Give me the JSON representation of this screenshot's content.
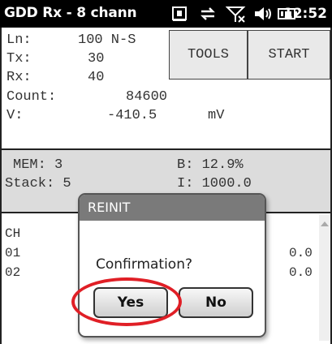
{
  "titlebar": {
    "title": "GDD Rx - 8 chann",
    "clock": "12:52",
    "icons": [
      "calendar-icon",
      "sync-icon",
      "signal-off-icon",
      "volume-icon",
      "battery-icon"
    ]
  },
  "info": {
    "ln_label": "Ln:",
    "ln_value": "100 N-S",
    "tx_label": "Tx:",
    "tx_value": "30",
    "rx_label": "Rx:",
    "rx_value": "40",
    "count_label": "Count:",
    "count_value": "84600",
    "v_label": "V:",
    "v_value": "-410.5",
    "v_unit": "mV",
    "tools_label": "TOOLS",
    "start_label": "START"
  },
  "stats": {
    "mem": "MEM: 3",
    "b": "B: 12.9%",
    "stack": "Stack: 5",
    "i": "I: 1000.0"
  },
  "table": {
    "header": "CH",
    "rows": [
      {
        "ch": "01",
        "val": "0.0"
      },
      {
        "ch": "02",
        "val": "0.0"
      }
    ]
  },
  "dialog": {
    "title": "REINIT",
    "message": "Confirmation?",
    "yes_label": "Yes",
    "no_label": "No"
  },
  "colors": {
    "highlight": "#e01f26",
    "titlebar": "#000000",
    "dialog_title": "#7a7a7a",
    "stats_bg": "#dcdcdc"
  }
}
